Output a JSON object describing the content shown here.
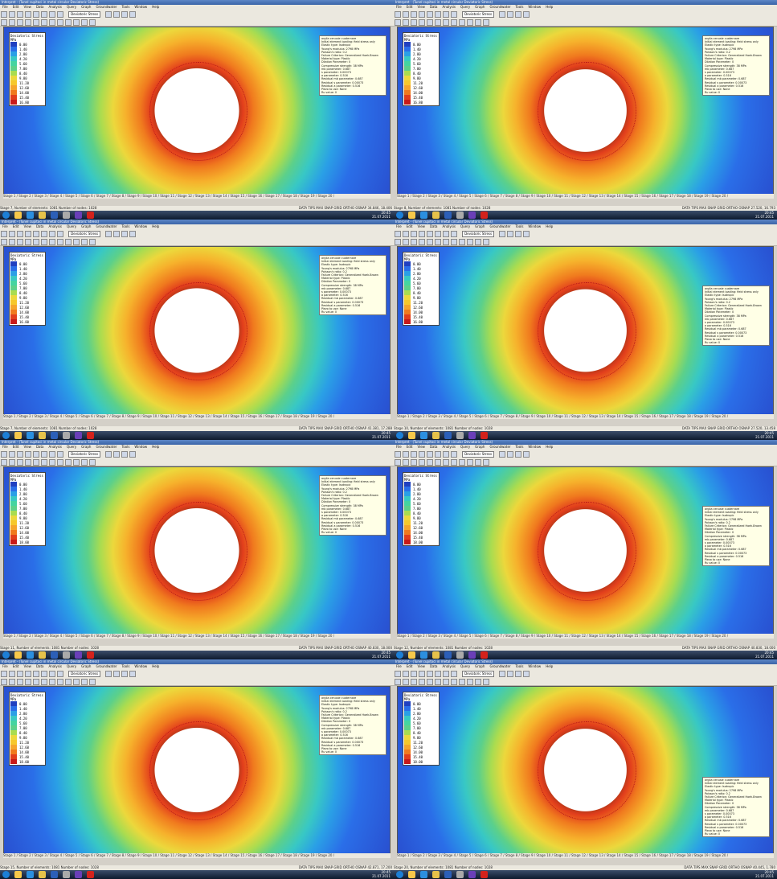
{
  "window": {
    "title": "Interpret - (Tunel cupitoci in metal circular Deviatoric Stress)",
    "menu": [
      "File",
      "Edit",
      "View",
      "Data",
      "Analysis",
      "Query",
      "Graph",
      "Groundwater",
      "Tools",
      "Window",
      "Help"
    ],
    "combo": "Deviatoric Stress"
  },
  "legend": {
    "title": "Deviatoric Stress",
    "unit": "MPa",
    "values": [
      "0.00",
      "1.40",
      "2.80",
      "4.20",
      "5.60",
      "7.00",
      "8.40",
      "9.80",
      "11.20",
      "12.60",
      "14.00",
      "15.40",
      "16.80"
    ],
    "colors": [
      "#2040c0",
      "#2a6ee8",
      "#2a9fe6",
      "#38c8c4",
      "#44d4a0",
      "#5cd08a",
      "#a9dc50",
      "#ecd83c",
      "#f6c82c",
      "#f6a52c",
      "#f07a1e",
      "#e23e1c",
      "#c81a1a"
    ]
  },
  "info": [
    "argila cenusie cuaternare",
    "Initial element loading: field stress only",
    "Elastic type: Isotropic",
    "Young's modulus: 2798 MPa",
    "Poisson's ratio: 0.2",
    "Failure Criterion: Generalized Hoek-Brown",
    "Material type: Plastic",
    "Dilation Parameter: 0",
    "Compressive strength: 38 MPa",
    "mb parameter: 0.687",
    "s parameter: 0.00073",
    "a parameter: 0.516",
    "Residual mb parameter: 0.687",
    "Residual s parameter: 0.00073",
    "Residual a parameter: 0.516",
    "Piezo to use: None",
    "Ru value: 0"
  ],
  "stage_tabs": "Stage 1 / Stage 2 / Stage 3 / Stage 4 / Stage 5 / Stage 6 / Stage 7 / Stage 8 / Stage 9 / Stage 10 / Stage 11 / Stage 12 / Stage 13 / Stage 14 / Stage 15 / Stage 16 / Stage 17 / Stage 18 / Stage 19 / Stage 20 /",
  "status_right": "DATA TIPS MAX   SNAP  GRID  ORTHO  OSNAP",
  "clock": {
    "time": "20:45",
    "date": "21.07.2011"
  },
  "panels": [
    {
      "stage": "Stage 7, Number of elements: 1081  Number of nodes: 1028",
      "coords": "34.846, 18.406",
      "legend_max": "16.80"
    },
    {
      "stage": "Stage 8, Number of elements: 1081  Number of nodes: 1028",
      "coords": "27.520, 16.793",
      "legend_max": "16.80"
    },
    {
      "stage": "Stage 7, Number of elements: 1081  Number of nodes: 1028",
      "coords": "41.381, 17.288",
      "legend_max": "16.80"
    },
    {
      "stage": "Stage 10, Number of elements: 1081  Number of nodes: 1028",
      "coords": "27.520, 13.458",
      "legend_max": "16.80"
    },
    {
      "stage": "Stage 11, Number of elements: 1081  Number of nodes: 1028",
      "coords": "40.830, 18.000",
      "legend_max": "18.00"
    },
    {
      "stage": "Stage 12, Number of elements: 1081  Number of nodes: 1028",
      "coords": "40.830, 18.000",
      "legend_max": "18.00"
    },
    {
      "stage": "Stage 15, Number of elements: 1081  Number of nodes: 1028",
      "coords": "42.871, 17.200",
      "legend_max": "18.00"
    },
    {
      "stage": "Stage 20, Number of elements: 1081  Number of nodes: 1028",
      "coords": "40.445, 1.780",
      "legend_max": "18.00"
    }
  ]
}
